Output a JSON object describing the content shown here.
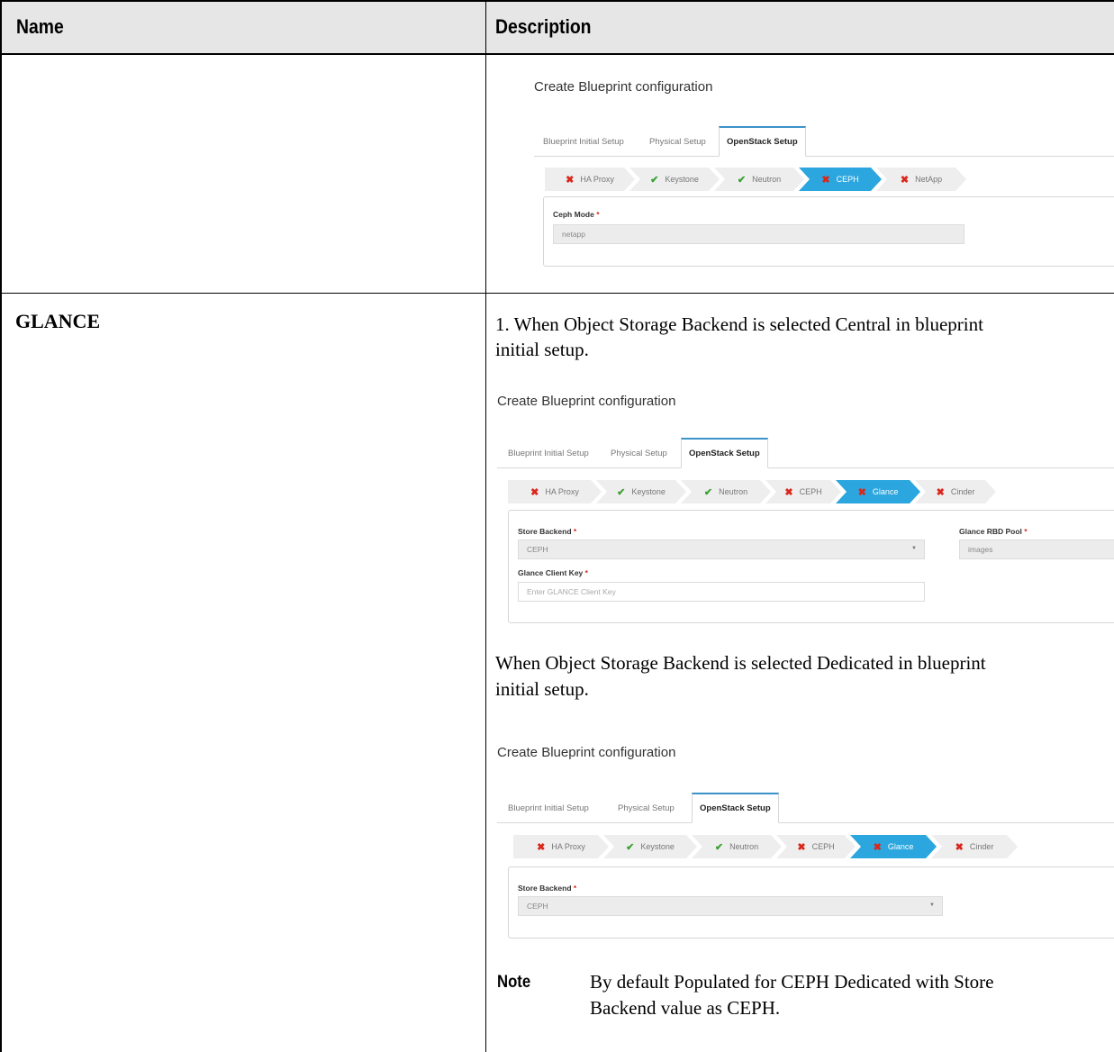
{
  "table": {
    "headers": {
      "name": "Name",
      "description": "Description"
    }
  },
  "rows": [
    {
      "name": "",
      "screenshot": {
        "title": "Create Blueprint configuration",
        "tabs": [
          "Blueprint Initial Setup",
          "Physical Setup",
          "OpenStack Setup"
        ],
        "active_tab": "OpenStack Setup",
        "steps": [
          {
            "label": "HA Proxy",
            "status": "error",
            "icon": "cross-icon"
          },
          {
            "label": "Keystone",
            "status": "ok",
            "icon": "check-icon"
          },
          {
            "label": "Neutron",
            "status": "ok",
            "icon": "check-icon"
          },
          {
            "label": "CEPH",
            "status": "error",
            "icon": "cross-icon",
            "active": true
          },
          {
            "label": "NetApp",
            "status": "error",
            "icon": "cross-icon"
          }
        ],
        "fields": [
          {
            "label": "Ceph Mode",
            "required": "*",
            "value": "netapp"
          }
        ]
      }
    },
    {
      "name": "GLANCE",
      "paragraph_1": "1. When Object Storage Backend is selected Central in blueprint initial setup.",
      "paragraph_1_lines": [
        "1. When Object Storage Backend is selected Central in blueprint",
        "initial setup."
      ],
      "screenshot_central": {
        "title": "Create Blueprint configuration",
        "tabs": [
          "Blueprint Initial Setup",
          "Physical Setup",
          "OpenStack Setup"
        ],
        "active_tab": "OpenStack Setup",
        "steps": [
          {
            "label": "HA Proxy",
            "status": "error",
            "icon": "cross-icon"
          },
          {
            "label": "Keystone",
            "status": "ok",
            "icon": "check-icon"
          },
          {
            "label": "Neutron",
            "status": "ok",
            "icon": "check-icon"
          },
          {
            "label": "CEPH",
            "status": "error",
            "icon": "cross-icon"
          },
          {
            "label": "Glance",
            "status": "error",
            "icon": "cross-icon",
            "active": true
          },
          {
            "label": "Cinder",
            "status": "error",
            "icon": "cross-icon"
          }
        ],
        "fields": [
          {
            "label": "Store Backend",
            "required": "*",
            "value": "CEPH"
          },
          {
            "label": "Glance RBD Pool",
            "required": "*",
            "value": "images"
          },
          {
            "label": "Glance Client Key",
            "required": "*",
            "placeholder": "Enter GLANCE Client Key"
          }
        ]
      },
      "paragraph_2_lines": [
        "When Object Storage Backend is selected Dedicated in blueprint",
        "initial setup."
      ],
      "screenshot_dedicated": {
        "title": "Create Blueprint configuration",
        "tabs": [
          "Blueprint Initial Setup",
          "Physical Setup",
          "OpenStack Setup"
        ],
        "active_tab": "OpenStack Setup",
        "steps": [
          {
            "label": "HA Proxy",
            "status": "error",
            "icon": "cross-icon"
          },
          {
            "label": "Keystone",
            "status": "ok",
            "icon": "check-icon"
          },
          {
            "label": "Neutron",
            "status": "ok",
            "icon": "check-icon"
          },
          {
            "label": "CEPH",
            "status": "error",
            "icon": "cross-icon"
          },
          {
            "label": "Glance",
            "status": "error",
            "icon": "cross-icon",
            "active": true
          },
          {
            "label": "Cinder",
            "status": "error",
            "icon": "cross-icon"
          }
        ],
        "fields": [
          {
            "label": "Store Backend",
            "required": "*",
            "value": "CEPH"
          }
        ]
      },
      "note": {
        "label": "Note",
        "lines": [
          "By default Populated for CEPH Dedicated with Store",
          "Backend value as CEPH."
        ]
      }
    }
  ],
  "colors": {
    "active_step": "#2ba6de",
    "error_icon": "#d9271c",
    "ok_icon": "#3aa033",
    "header_bg": "#e6e6e6",
    "tab_accent": "#3b93c9"
  }
}
